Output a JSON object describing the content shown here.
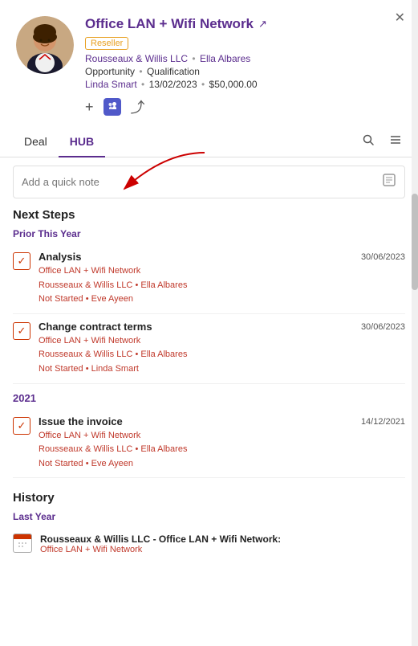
{
  "header": {
    "title": "Office LAN + Wifi Network",
    "external_link_symbol": "↗",
    "close_symbol": "✕",
    "badge": "Reseller",
    "meta1_company": "Rousseaux & Willis LLC",
    "meta1_person": "Ella Albares",
    "meta2_type": "Opportunity",
    "meta2_stage": "Qualification",
    "meta3_person": "Linda Smart",
    "meta3_date": "13/02/2023",
    "meta3_amount": "$50,000.00",
    "actions": {
      "plus_symbol": "+",
      "teams_label": "Teams",
      "share_symbol": "⤴"
    }
  },
  "tabs": {
    "items": [
      {
        "label": "Deal",
        "active": false
      },
      {
        "label": "HUB",
        "active": true
      }
    ],
    "search_symbol": "🔍",
    "menu_symbol": "≡"
  },
  "quick_note": {
    "placeholder": "Add a quick note",
    "icon": "📋"
  },
  "next_steps": {
    "title": "Next Steps",
    "groups": [
      {
        "label": "Prior This Year",
        "tasks": [
          {
            "name": "Analysis",
            "company": "Office LAN + Wifi Network",
            "org": "Rousseaux & Willis LLC",
            "person": "Ella Albares",
            "status": "Not Started",
            "assigned": "Eve Ayeen",
            "date": "30/06/2023"
          },
          {
            "name": "Change contract terms",
            "company": "Office LAN + Wifi Network",
            "org": "Rousseaux & Willis LLC",
            "person": "Ella Albares",
            "status": "Not Started",
            "assigned": "Linda Smart",
            "date": "30/06/2023"
          }
        ]
      },
      {
        "label": "2021",
        "tasks": [
          {
            "name": "Issue the invoice",
            "company": "Office LAN + Wifi Network",
            "org": "Rousseaux & Willis LLC",
            "person": "Ella Albares",
            "status": "Not Started",
            "assigned": "Eve Ayeen",
            "date": "14/12/2021"
          }
        ]
      }
    ]
  },
  "history": {
    "title": "History",
    "groups": [
      {
        "label": "Last Year",
        "items": [
          {
            "text": "Rousseaux & Willis LLC - Office LAN + Wifi Network:",
            "sub": "Office LAN + Wifi Network"
          }
        ]
      }
    ]
  },
  "colors": {
    "purple": "#5b2d8e",
    "red": "#cc3300",
    "orange": "#e8a020"
  }
}
